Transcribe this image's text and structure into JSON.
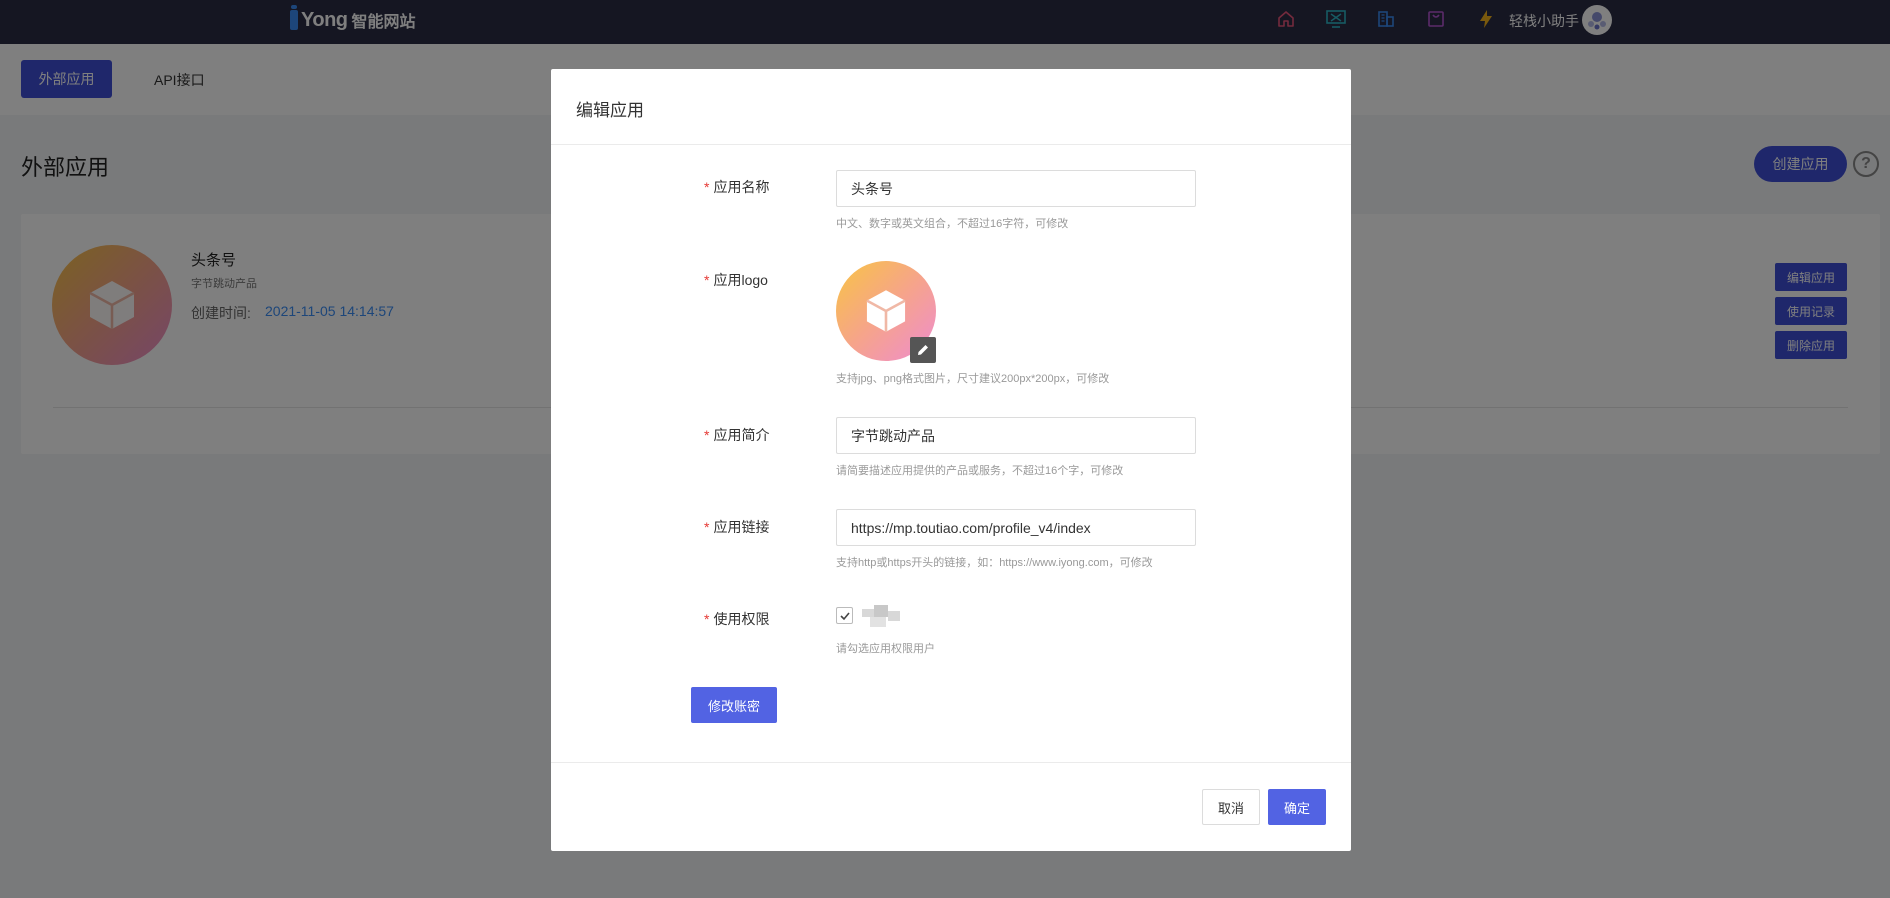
{
  "header": {
    "brand": "Yong",
    "brand_sub": "智能网站",
    "icons": [
      "home-icon",
      "monitor-icon",
      "building-icon",
      "bag-icon",
      "lightning-icon"
    ],
    "user_name": "轻栈小助手"
  },
  "subheader": {
    "tabs": [
      {
        "label": "外部应用",
        "active": true
      },
      {
        "label": "API接口",
        "active": false
      }
    ]
  },
  "page": {
    "title": "外部应用",
    "create_button": "创建应用",
    "help": "?"
  },
  "app_card": {
    "name": "头条号",
    "description": "字节跳动产品",
    "created_label": "创建时间:",
    "created_time": "2021-11-05 14:14:57",
    "actions": [
      "编辑应用",
      "使用记录",
      "删除应用"
    ]
  },
  "modal": {
    "title": "编辑应用",
    "fields": {
      "name": {
        "label": "应用名称",
        "value": "头条号",
        "hint": "中文、数字或英文组合，不超过16字符，可修改"
      },
      "logo": {
        "label": "应用logo",
        "hint": "支持jpg、png格式图片，尺寸建议200px*200px，可修改"
      },
      "intro": {
        "label": "应用简介",
        "value": "字节跳动产品",
        "hint": "请简要描述应用提供的产品或服务，不超过16个字，可修改"
      },
      "link": {
        "label": "应用链接",
        "value": "https://mp.toutiao.com/profile_v4/index",
        "hint": "支持http或https开头的链接，如：https://www.iyong.com，可修改"
      },
      "permission": {
        "label": "使用权限",
        "checked": true,
        "hint": "请勾选应用权限用户"
      }
    },
    "required_mark": "*",
    "change_account_button": "修改账密",
    "cancel_button": "取消",
    "confirm_button": "确定"
  },
  "colors": {
    "topbar": "#2a2d44",
    "primary": "#3f4ed6",
    "modal_primary": "#5263e3",
    "link": "#3a8df5",
    "required": "#e53935"
  }
}
